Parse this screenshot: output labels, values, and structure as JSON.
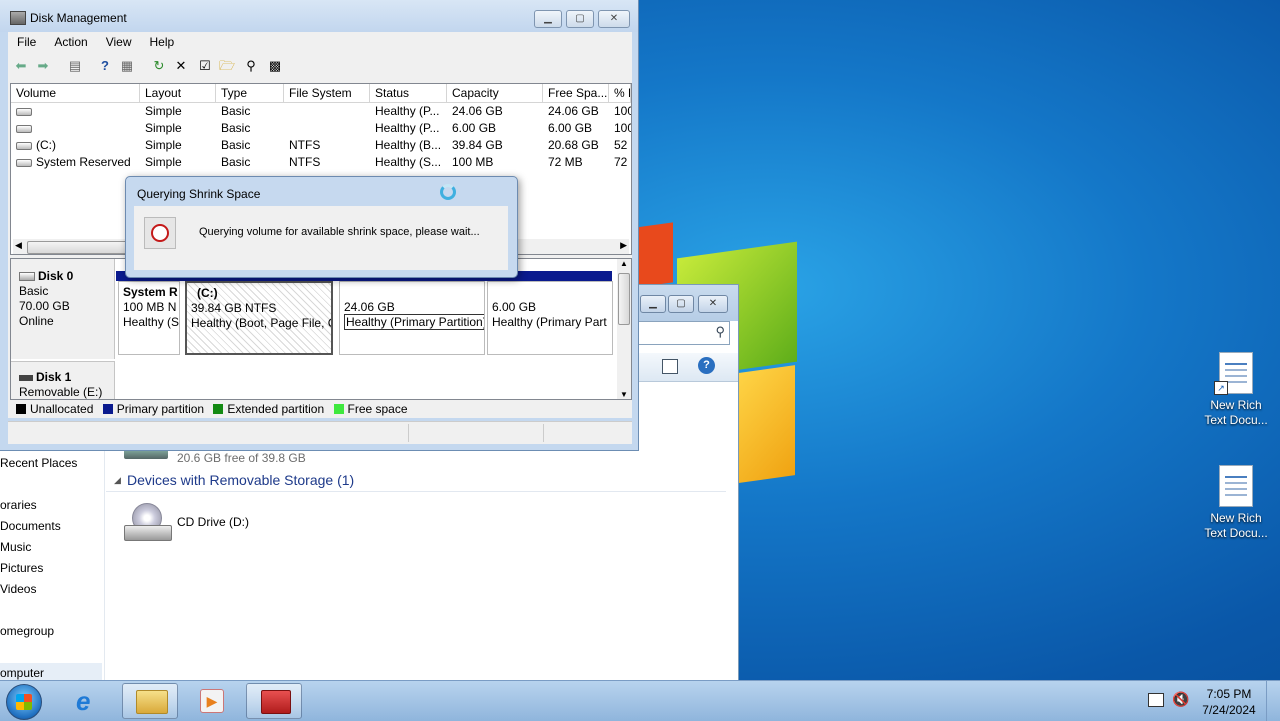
{
  "desktop": {
    "icons": [
      {
        "label": "New Rich Text Docu...",
        "name": "rtf-icon-1"
      },
      {
        "label": "New Rich Text Docu...",
        "name": "rtf-icon-2"
      }
    ]
  },
  "explorer": {
    "nav": [
      "Recent Places",
      "oraries",
      "Documents",
      "Music",
      "Pictures",
      "Videos",
      "omegroup",
      "omputer"
    ],
    "drive_free": "20.6 GB free of 39.8 GB",
    "removable_header": "Devices with Removable Storage (1)",
    "cd_drive": "CD Drive (D:)"
  },
  "disk_mgmt": {
    "title": "Disk Management",
    "menu": [
      "File",
      "Action",
      "View",
      "Help"
    ],
    "columns": [
      "Volume",
      "Layout",
      "Type",
      "File System",
      "Status",
      "Capacity",
      "Free Spa...",
      "% F"
    ],
    "rows": [
      {
        "volume": "",
        "layout": "Simple",
        "type": "Basic",
        "fs": "",
        "status": "Healthy (P...",
        "capacity": "24.06 GB",
        "free": "24.06 GB",
        "pct": "100"
      },
      {
        "volume": "",
        "layout": "Simple",
        "type": "Basic",
        "fs": "",
        "status": "Healthy (P...",
        "capacity": "6.00 GB",
        "free": "6.00 GB",
        "pct": "100"
      },
      {
        "volume": "(C:)",
        "layout": "Simple",
        "type": "Basic",
        "fs": "NTFS",
        "status": "Healthy (B...",
        "capacity": "39.84 GB",
        "free": "20.68 GB",
        "pct": "52"
      },
      {
        "volume": "System Reserved",
        "layout": "Simple",
        "type": "Basic",
        "fs": "NTFS",
        "status": "Healthy (S...",
        "capacity": "100 MB",
        "free": "72 MB",
        "pct": "72"
      }
    ],
    "disk0": {
      "name": "Disk 0",
      "kind": "Basic",
      "size": "70.00 GB",
      "state": "Online",
      "partitions": [
        {
          "name": "System R",
          "l1": "100 MB N",
          "l2": "Healthy (S"
        },
        {
          "name": "(C:)",
          "l1": "39.84 GB NTFS",
          "l2": "Healthy (Boot, Page File, C"
        },
        {
          "name": "",
          "l1": "24.06 GB",
          "l2": "Healthy (Primary Partition)"
        },
        {
          "name": "",
          "l1": "6.00 GB",
          "l2": "Healthy (Primary Part"
        }
      ]
    },
    "disk1": {
      "name": "Disk 1",
      "kind": "Removable (E:)"
    },
    "legend": [
      {
        "label": "Unallocated",
        "color": "#000000"
      },
      {
        "label": "Primary partition",
        "color": "#0a1a8e"
      },
      {
        "label": "Extended partition",
        "color": "#138a13"
      },
      {
        "label": "Free space",
        "color": "#3ee83e"
      }
    ]
  },
  "dialog": {
    "title": "Querying Shrink Space",
    "message": "Querying volume for available shrink space, please wait..."
  },
  "taskbar": {
    "time": "7:05 PM",
    "date": "7/24/2024"
  }
}
